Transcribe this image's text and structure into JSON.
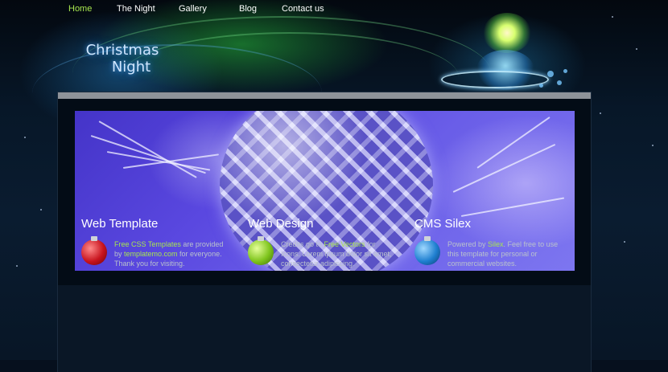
{
  "nav": {
    "items": [
      {
        "label": "Home",
        "active": true
      },
      {
        "label": "The Night",
        "active": false
      },
      {
        "label": "Gallery",
        "active": false
      },
      {
        "label": "Blog",
        "active": false
      },
      {
        "label": "Contact us",
        "active": false
      }
    ]
  },
  "logo": {
    "line1": "Christmas",
    "line2": "Night"
  },
  "colors": {
    "accent_green": "#a7e64f",
    "frame_gray": "#8e9399",
    "text_muted": "#b9c2cc"
  },
  "columns": [
    {
      "title": "Web Template",
      "icon": "red-ornament-icon",
      "icon_color": "#c8141e",
      "link1": "Free CSS Templates",
      "text1": " are provided by ",
      "link2": "templatemo.com",
      "text2": " for everyone. Thank you for visiting."
    },
    {
      "title": "Web Design",
      "icon": "green-ornament-icon",
      "icon_color": "#7ec41c",
      "text0": "Credits go to ",
      "link1": "Free Vectors",
      "text1": " for Icons. Lorem ipsum dolor sit amet, consectetur adipiscing."
    },
    {
      "title": "CMS Silex",
      "icon": "blue-ornament-icon",
      "icon_color": "#1f7fd0",
      "text0": "Powered by ",
      "link1": "Silex",
      "text1": ". Feel free to use this template for personal or commercial websites."
    }
  ]
}
